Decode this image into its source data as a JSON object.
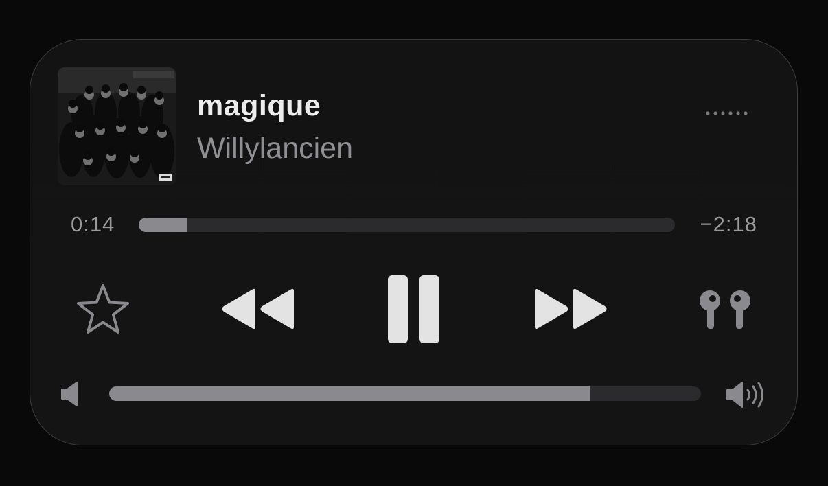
{
  "now_playing": {
    "title": "magique",
    "artist": "Willylancien",
    "elapsed": "0:14",
    "remaining": "−2:18",
    "progress": 0.09,
    "volume": 0.812,
    "playing": true
  },
  "icons": {
    "more": "more-dots-icon",
    "favorite": "star-outline-icon",
    "rewind": "backward-icon",
    "pause": "pause-icon",
    "forward": "forward-icon",
    "output": "airpods-icon",
    "volume_low": "speaker-low-icon",
    "volume_high": "speaker-high-icon"
  },
  "colors": {
    "background": "#090909",
    "card": "#131313",
    "primary_text": "#ececec",
    "secondary_text": "#8e8e93",
    "track": "#2b2b2d",
    "fill": "#8a8a8e"
  }
}
